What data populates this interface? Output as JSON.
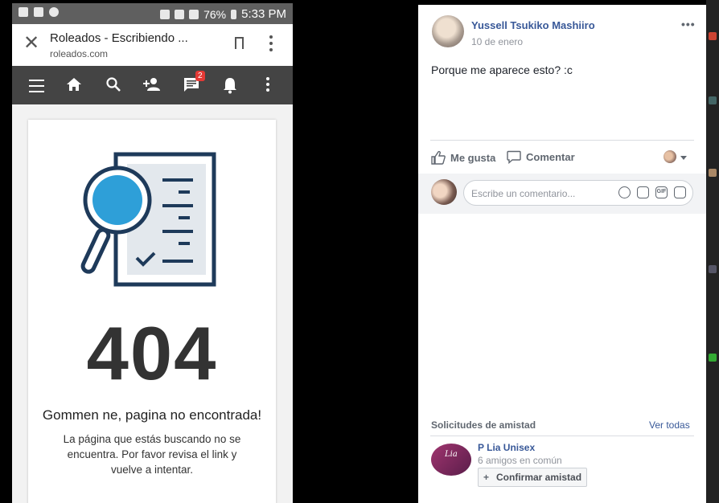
{
  "status_bar": {
    "battery": "76%",
    "time": "5:33 PM"
  },
  "browser": {
    "page_title": "Roleados - Escribiendo ...",
    "url": "roleados.com",
    "close_glyph": "✕"
  },
  "site_nav": {
    "messages_badge": "2",
    "icons": [
      "menu-icon",
      "home-icon",
      "search-icon",
      "add-friend-icon",
      "messages-icon",
      "bell-icon",
      "more-icon"
    ]
  },
  "error_page": {
    "code": "404",
    "title": "Gommen ne, pagina no encontrada!",
    "description": "La página que estás buscando no se encuentra. Por favor revisa el link y vuelve a intentar."
  },
  "post": {
    "author": "Yussell Tsukiko Mashiiro",
    "date": "10 de enero",
    "text": "Porque me aparece esto? :c",
    "options_glyph": "•••",
    "actions": {
      "like": "Me gusta",
      "comment": "Comentar"
    },
    "comment_placeholder": "Escribe un comentario..."
  },
  "friend_requests": {
    "title": "Solicitudes de amistad",
    "see_all": "Ver todas",
    "item": {
      "name": "P Lia Unisex",
      "mutual": "6 amigos en común",
      "confirm": "Confirmar amistad",
      "logo_text": "Lia"
    }
  },
  "colors": {
    "fb_link": "#385898",
    "nav_bg": "#444444",
    "badge": "#e53935",
    "illustration_blue": "#2e9fd8",
    "illustration_navy": "#1e3a5a"
  }
}
